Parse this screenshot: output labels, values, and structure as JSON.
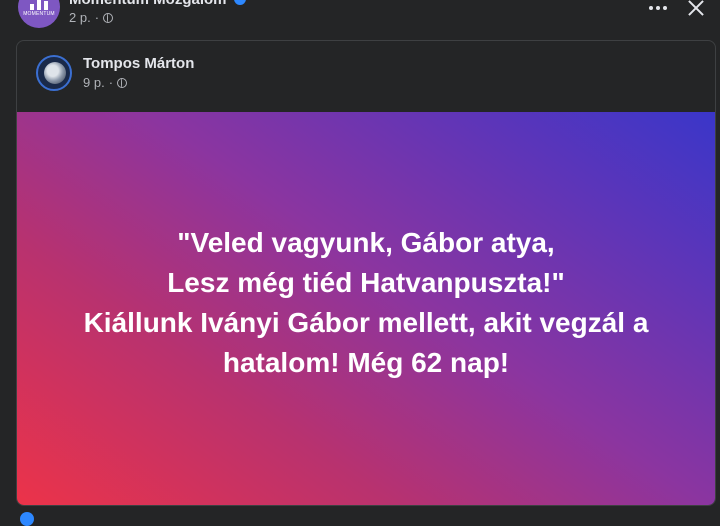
{
  "header": {
    "page_name": "Momentum Mozgalom",
    "avatar_caption": "MOMENTUM",
    "time": "2 p.",
    "separator": "·",
    "privacy_icon": "globe-icon",
    "more_icon": "more-horizontal-icon",
    "close_icon": "close-icon"
  },
  "shared_post": {
    "author": "Tompos Márton",
    "time": "9 p.",
    "separator": "·",
    "privacy_icon": "globe-icon",
    "image_text": [
      "\"Veled vagyunk, Gábor atya,",
      "Lesz még tiéd Hatvanpuszta!\"",
      "Kiállunk Iványi Gábor mellett, akit vegzál a",
      "hatalom! Még 62 nap!"
    ]
  },
  "colors": {
    "background": "#242526",
    "text_primary": "#e4e6eb",
    "text_secondary": "#b0b3b8",
    "gradient_start": "#ec3349",
    "gradient_end": "#3a36c9",
    "verified_badge": "#2d88ff"
  }
}
